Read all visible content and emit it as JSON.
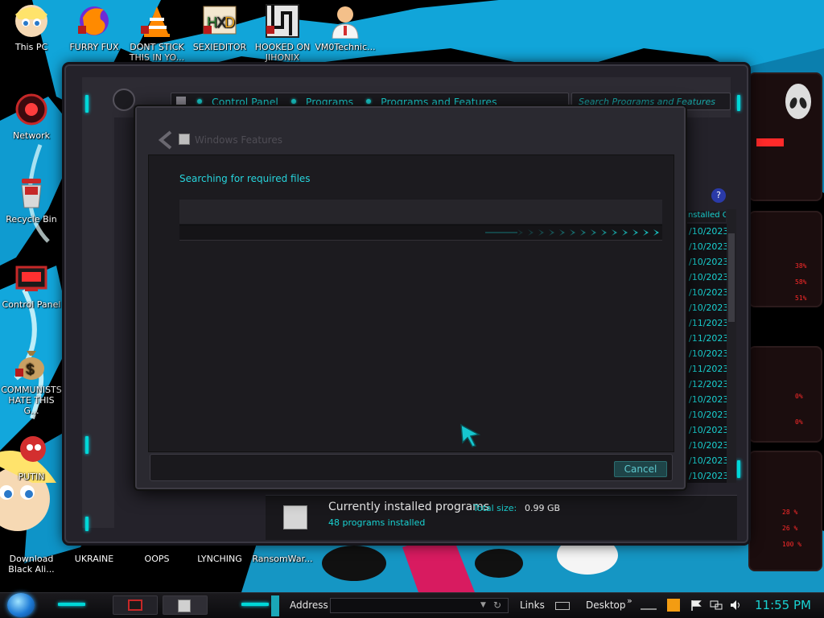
{
  "desktop": {
    "icons": [
      {
        "label": "This PC"
      },
      {
        "label": "FURRY FUX"
      },
      {
        "label": "DONT STICK THIS IN YO..."
      },
      {
        "label": "SEXIEDITOR"
      },
      {
        "label": "HOOKED ON JIHONIX"
      },
      {
        "label": "VM0Technic..."
      },
      {
        "label": "Network"
      },
      {
        "label": "Recycle Bin"
      },
      {
        "label": "Control Panel"
      },
      {
        "label": "COMMUNISTS HATE THIS G..."
      },
      {
        "label": "PUTIN"
      },
      {
        "label": "Download Black Ali..."
      },
      {
        "label": "UKRAINE"
      },
      {
        "label": "OOPS"
      },
      {
        "label": "LYNCHING"
      },
      {
        "label": "RansomWar..."
      }
    ]
  },
  "control_panel": {
    "breadcrumb": [
      "Control Panel",
      "Programs",
      "Programs and Features"
    ],
    "search_placeholder": "Search Programs and Features",
    "column_header": "Installed On",
    "dates": [
      "/10/2023",
      "/10/2023",
      "/10/2023",
      "/10/2023",
      "/10/2023",
      "/10/2023",
      "/11/2023",
      "/11/2023",
      "/10/2023",
      "/11/2023",
      "/12/2023",
      "/10/2023",
      "/10/2023",
      "/10/2023",
      "/10/2023",
      "/10/2023",
      "/10/2023"
    ],
    "status": {
      "title": "Currently installed programs",
      "total_size_label": "Total size:",
      "total_size_value": "0.99 GB",
      "count": "48 programs installed"
    }
  },
  "windows_features": {
    "title": "Windows Features",
    "status_text": "Searching for required files",
    "cancel_label": "Cancel"
  },
  "taskbar": {
    "address_label": "Address",
    "links_label": "Links",
    "desktop_label": "Desktop",
    "clock": "11:55 PM"
  },
  "colors": {
    "accent": "#19d2d2",
    "gadget_red": "#ff2a2a"
  }
}
